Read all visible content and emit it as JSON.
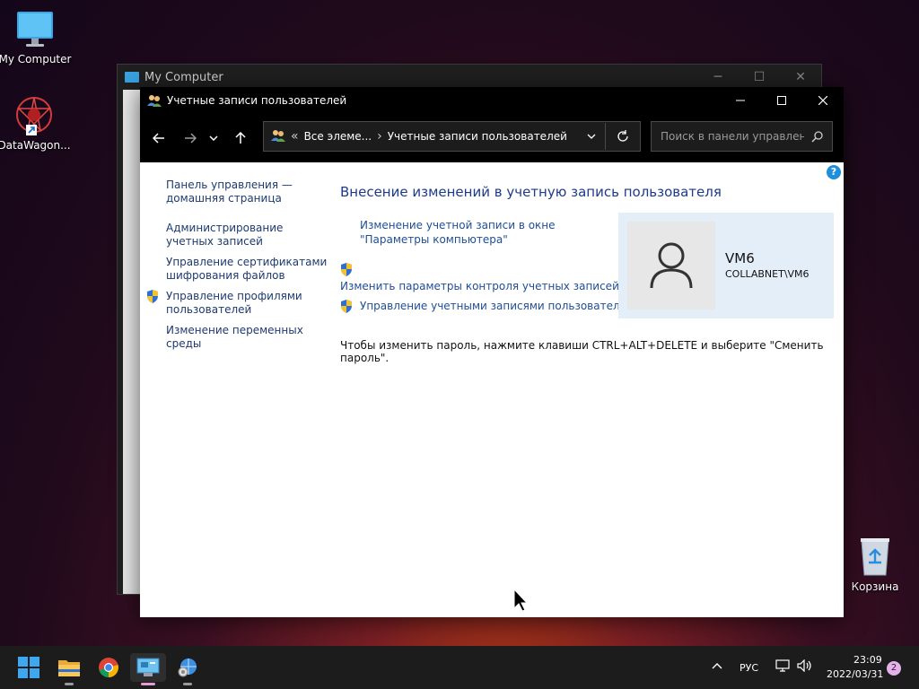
{
  "desktop": {
    "icons": [
      {
        "label": "My Computer"
      },
      {
        "label": "DataWagon..."
      },
      {
        "label": "Корзина"
      }
    ]
  },
  "background_window": {
    "title": "My Computer"
  },
  "window": {
    "title": "Учетные записи пользователей",
    "address": {
      "chevron": "«",
      "segment1": "Все элеме...",
      "separator": "›",
      "segment2": "Учетные записи пользователей"
    },
    "search_placeholder": "Поиск в панели управления",
    "help_label": "?",
    "sidebar": {
      "items": [
        {
          "label": "Панель управления — домашняя страница"
        },
        {
          "label": "Администрирование учетных записей"
        },
        {
          "label": "Управление сертификатами шифрования файлов"
        },
        {
          "label": "Управление профилями пользователей"
        },
        {
          "label": "Изменение переменных среды"
        }
      ]
    },
    "main": {
      "heading": "Внесение изменений в учетную запись пользователя",
      "link_settings": "Изменение учетной записи в окне \"Параметры компьютера\"",
      "link_uac": "Изменить параметры контроля учетных записей",
      "link_manage": "Управление учетными записями пользователей",
      "password_notice": "Чтобы изменить пароль, нажмите клавиши CTRL+ALT+DELETE и выберите \"Сменить пароль\"."
    },
    "user": {
      "name": "VM6",
      "domain": "COLLABNET\\VM6"
    }
  },
  "taskbar": {
    "lang": "РУС",
    "time": "23:09",
    "date": "2022/03/31",
    "notifications": "2"
  },
  "colors": {
    "link": "#1f4e96",
    "heading": "#1e3a8a",
    "taskbar": "#1c1c1c"
  }
}
